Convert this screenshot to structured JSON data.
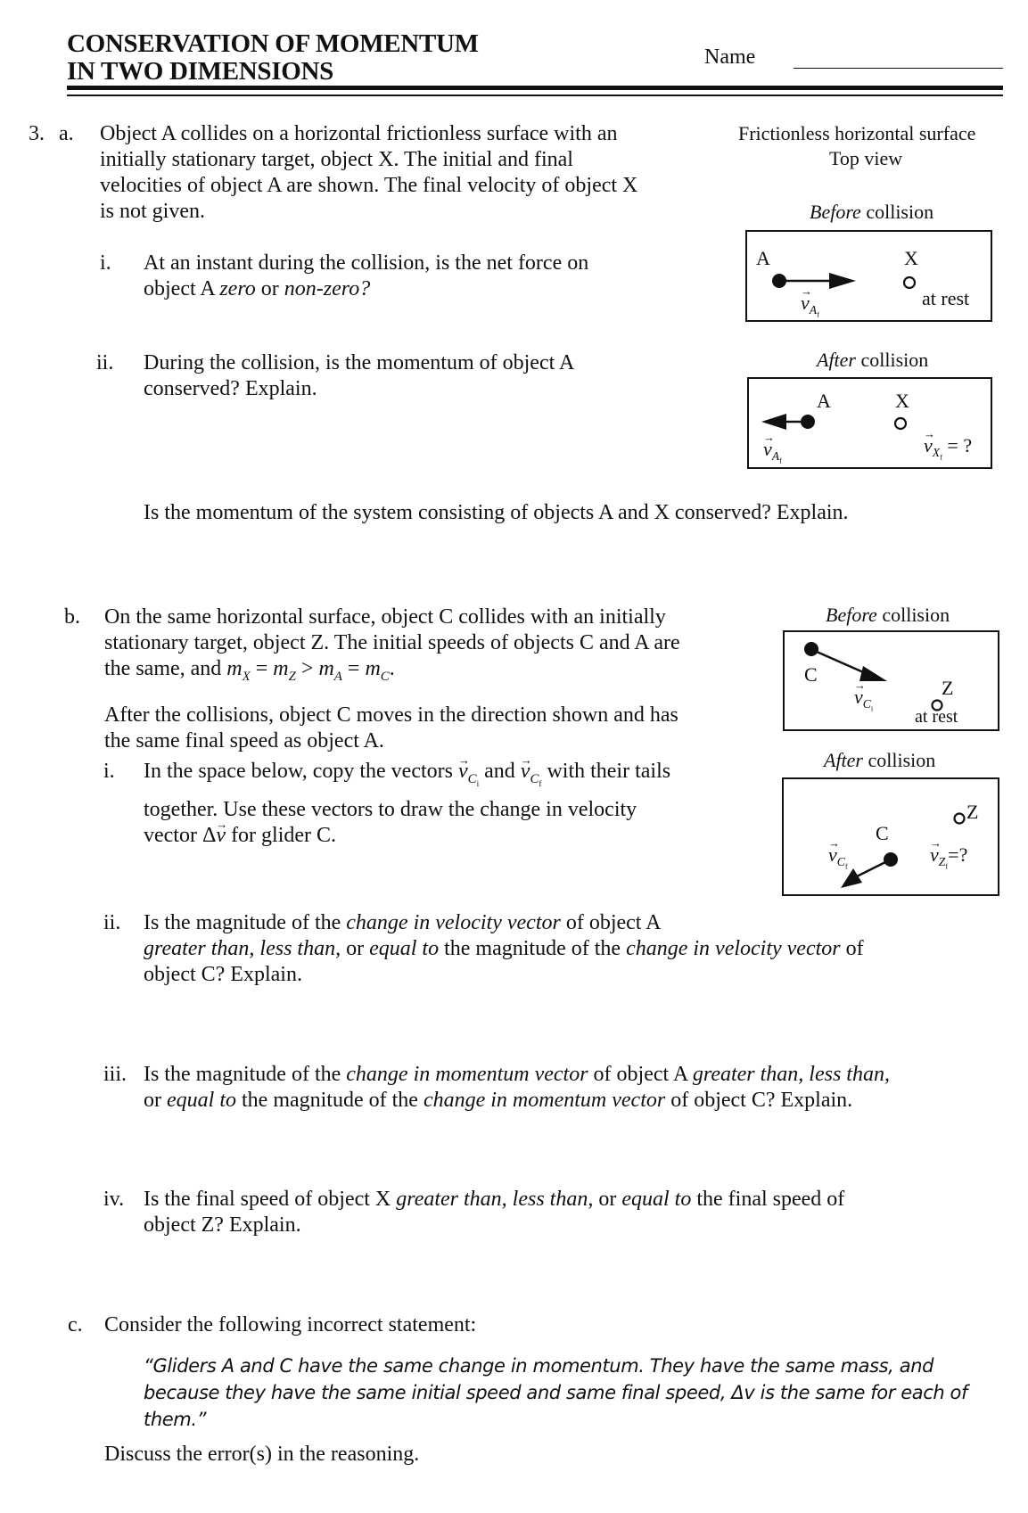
{
  "header": {
    "title_line1": "CONSERVATION OF MOMENTUM",
    "title_line2": "IN TWO DIMENSIONS",
    "name_label": "Name"
  },
  "problem": {
    "number": "3.",
    "part_a": {
      "label": "a.",
      "text": [
        "Object A collides on a horizontal frictionless surface with an",
        "initially stationary target, object X.  The initial and final",
        "velocities of object A are shown.  The final velocity of object X",
        "is not given."
      ],
      "q_i": {
        "label": "i.",
        "line1": "At an instant during the collision, is the net force on",
        "line2_prefix": "object A ",
        "line2_it1": "zero",
        "line2_mid": " or ",
        "line2_it2": "non-zero?"
      },
      "q_ii": {
        "label": "ii.",
        "line1": "During the collision, is the momentum of object A",
        "line2": "conserved?  Explain."
      },
      "q_system": "Is the momentum of the system consisting of objects A and X conserved?  Explain.",
      "diagram": {
        "heading1": "Frictionless horizontal surface",
        "heading2": "Top view",
        "before_it": "Before",
        "before_rest": " collision",
        "after_it": "After",
        "after_rest": " collision",
        "before": {
          "label_A": "A",
          "label_X": "X",
          "vec_base": "v",
          "vec_sub_letter": "A",
          "vec_sub": "f",
          "rest_label": "at rest"
        },
        "after": {
          "label_A": "A",
          "label_X": "X",
          "vecA_base": "v",
          "vecA_sub_letter": "A",
          "vecA_sub": "f",
          "vecX_base": "v",
          "vecX_sub_letter": "X",
          "vecX_sub": "f",
          "vecX_suffix": " = ?"
        }
      }
    },
    "part_b": {
      "label": "b.",
      "line1": "On the same horizontal surface, object C collides with an initially",
      "line2": "stationary target, object Z.  The initial speeds of objects C and A are",
      "line3_prefix": "the same, and ",
      "mass_relation": {
        "m": "m",
        "X": "X",
        "Z": "Z",
        "A": "A",
        "C": "C",
        "eq": " = ",
        "gt": " > "
      },
      "after_line1": "After the collisions, object C moves in the direction shown and has",
      "after_line2": "the same final speed as object A.",
      "q_i": {
        "label": "i.",
        "line1_a": "In the space below, copy the vectors ",
        "line1_b": " and ",
        "line1_c": " with their tails",
        "line2": "together.  Use these vectors to draw the change in velocity",
        "line3_a": "vector Δ",
        "line3_b": "  for glider C."
      },
      "q_ii": {
        "label": "ii.",
        "l1_a": "Is the magnitude of the ",
        "l1_it": "change in velocity vector",
        "l1_b": " of object A",
        "l2_it1": "greater than, less than,",
        "l2_a": " or ",
        "l2_it2": "equal to",
        "l2_b": " the magnitude of the ",
        "l2_it3": "change in velocity vector",
        "l2_c": " of",
        "l3": "object C?  Explain."
      },
      "q_iii": {
        "label": "iii.",
        "l1_a": "Is the magnitude of the ",
        "l1_it": "change in momentum vector",
        "l1_b": " of object A ",
        "l1_it2": "greater than, less than,",
        "l2_a": "or ",
        "l2_it": "equal to",
        "l2_b": " the magnitude of the ",
        "l2_it2": "change in momentum vector",
        "l2_c": " of object C?  Explain."
      },
      "q_iv": {
        "label": "iv.",
        "l1_a": "Is the final speed of object X ",
        "l1_it": "greater than, less than,",
        "l1_b": " or ",
        "l1_it2": "equal to",
        "l1_c": " the final speed of",
        "l2": "object Z?  Explain."
      },
      "diagram": {
        "before_it": "Before",
        "before_rest": " collision",
        "after_it": "After",
        "after_rest": " collision",
        "before": {
          "label_C": "C",
          "label_Z": "Z",
          "vec_base": "v",
          "vec_sub_letter": "C",
          "vec_sub": "i",
          "rest_label": "at rest"
        },
        "after": {
          "label_C": "C",
          "label_Z": "Z",
          "vecC_base": "v",
          "vecC_sub_letter": "C",
          "vecC_sub": "f",
          "vecZ_base": "v",
          "vecZ_sub_letter": "Z",
          "vecZ_sub": "f",
          "vecZ_suffix": "=?"
        }
      }
    },
    "part_c": {
      "label": "c.",
      "intro": "Consider the following incorrect statement:",
      "quote": [
        "“Gliders A and C have the same change in momentum.  They have the same mass, and",
        "because they have the same initial speed and same final speed, Δv is the same for each of",
        "them.”"
      ],
      "prompt": "Discuss the error(s) in the reasoning."
    }
  }
}
